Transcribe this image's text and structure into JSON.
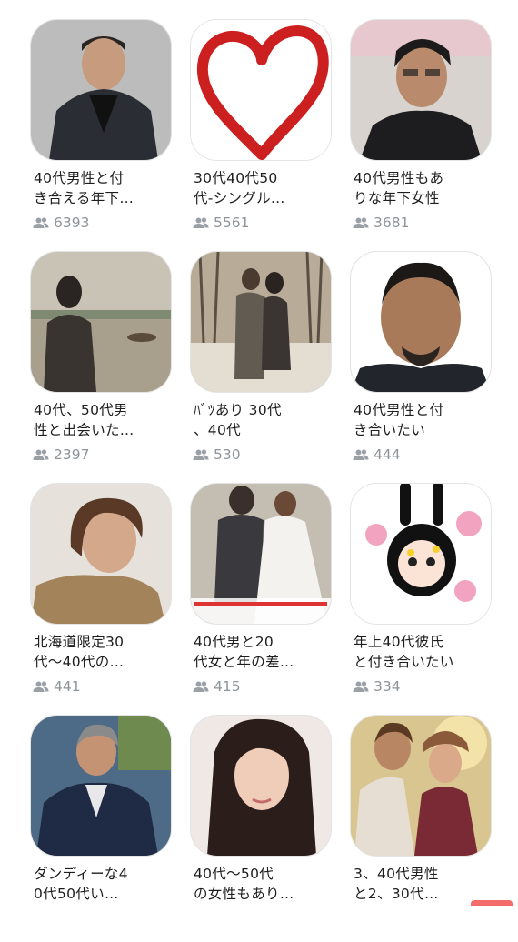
{
  "colors": {
    "accent": "#f36b6b",
    "meta_text": "#8e9499",
    "title_text": "#1d1d1d"
  },
  "groups": [
    {
      "title": "40代男性と付\nき合える年下…",
      "members": "6393",
      "thumb": "man-dark-suit"
    },
    {
      "title": "30代40代50\n代-シングル…",
      "members": "5561",
      "thumb": "red-heart"
    },
    {
      "title": "40代男性もあ\nりな年下女性",
      "members": "3681",
      "thumb": "man-glasses-portrait"
    },
    {
      "title": "40代、50代男\n性と出会いた…",
      "members": "2397",
      "thumb": "woman-by-lake"
    },
    {
      "title": "ﾊﾞﾂあり 30代\n、40代",
      "members": "530",
      "thumb": "couple-walking-park"
    },
    {
      "title": "40代男性と付\nき合いたい",
      "members": "444",
      "thumb": "man-goatee-portrait"
    },
    {
      "title": "北海道限定30\n代～40代の…",
      "members": "441",
      "thumb": "woman-short-hair"
    },
    {
      "title": "40代男と20\n代女と年の差…",
      "members": "415",
      "thumb": "wedding-couple"
    },
    {
      "title": "年上40代彼氏\nと付き合いたい",
      "members": "334",
      "thumb": "cartoon-bunny-girl"
    },
    {
      "title": "ダンディーな4\n0代50代い…",
      "members": "",
      "thumb": "man-navy-suit"
    },
    {
      "title": "40代～50代\nの女性もあり…",
      "members": "",
      "thumb": "woman-long-hair"
    },
    {
      "title": "3、40代男性\nと2、30代…",
      "members": "",
      "thumb": "couple-embrace"
    }
  ]
}
